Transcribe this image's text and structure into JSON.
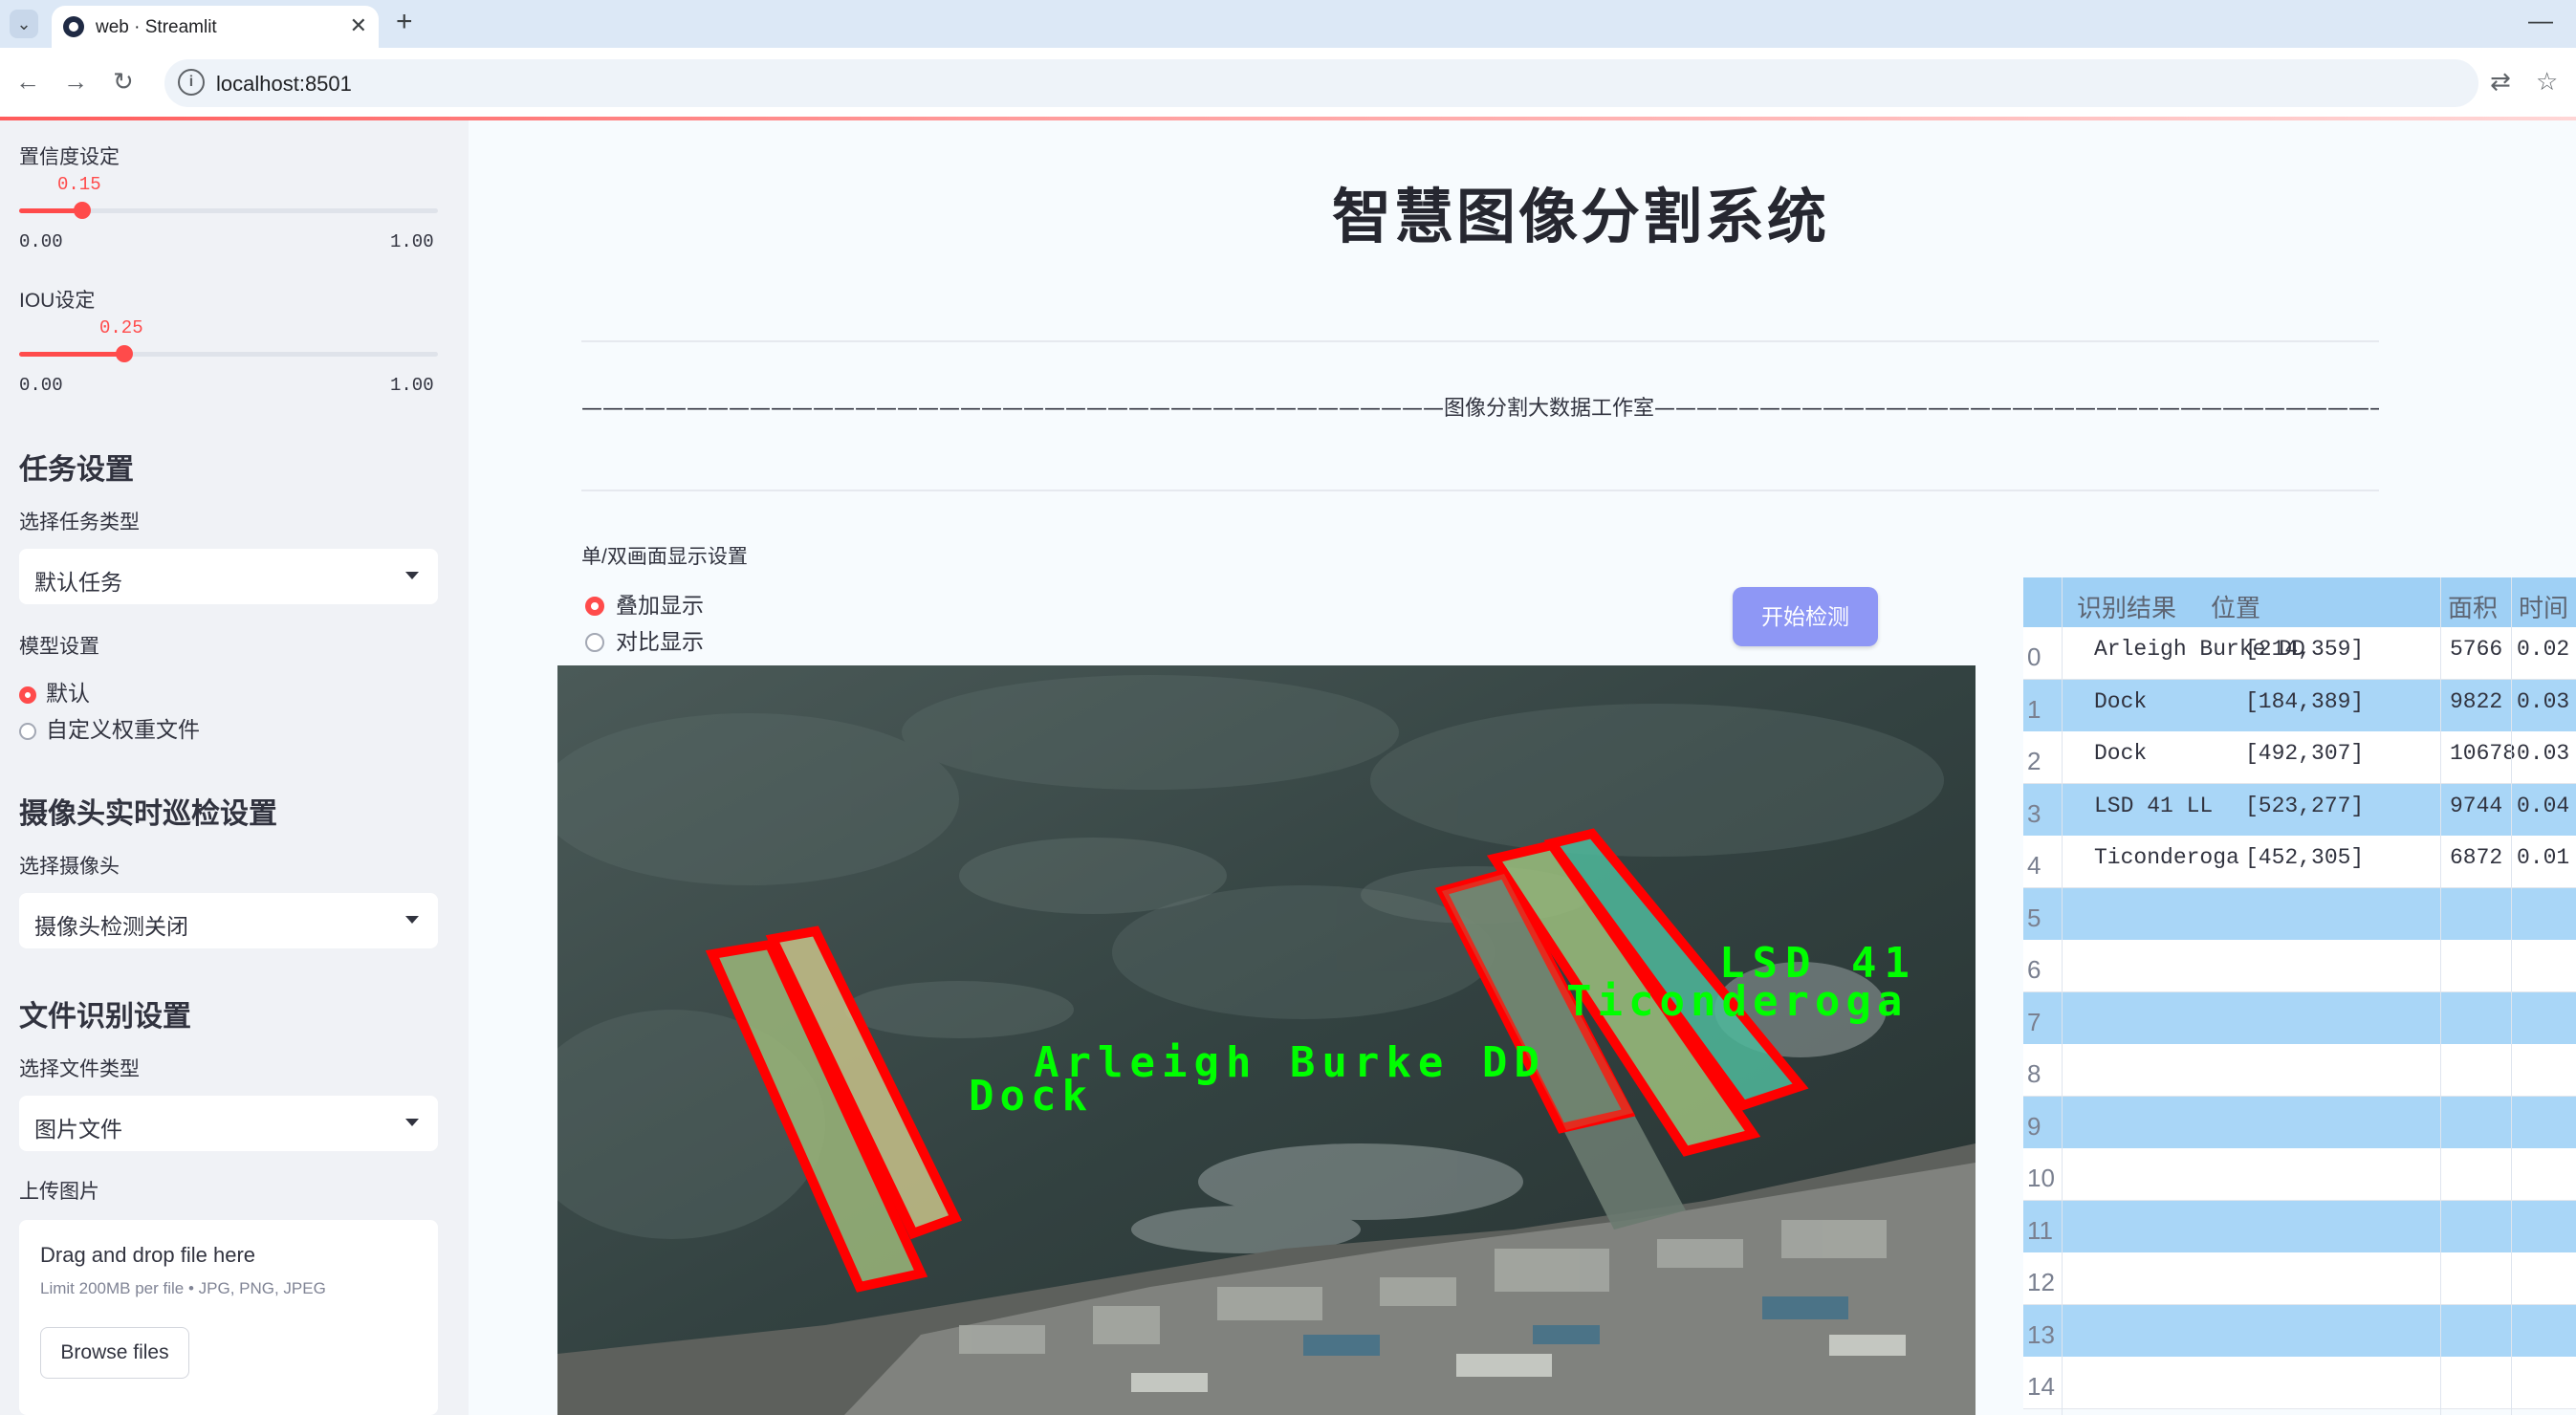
{
  "browser": {
    "tab_title": "web · Streamlit",
    "url": "localhost:8501"
  },
  "sidebar": {
    "confidence": {
      "label": "置信度设定",
      "value": "0.15",
      "min": "0.00",
      "max": "1.00",
      "fraction": 0.15
    },
    "iou": {
      "label": "IOU设定",
      "value": "0.25",
      "min": "0.00",
      "max": "1.00",
      "fraction": 0.25
    },
    "task_section": "任务设置",
    "task_type_label": "选择任务类型",
    "task_type_value": "默认任务",
    "model_label": "模型设置",
    "model_options": [
      "默认",
      "自定义权重文件"
    ],
    "camera_section": "摄像头实时巡检设置",
    "camera_label": "选择摄像头",
    "camera_value": "摄像头检测关闭",
    "file_section": "文件识别设置",
    "file_type_label": "选择文件类型",
    "file_type_value": "图片文件",
    "upload_label": "上传图片",
    "upload_drop": "Drag and drop file here",
    "upload_limit": "Limit 200MB per file • JPG, PNG, JPEG",
    "upload_button": "Browse files"
  },
  "main": {
    "title": "智慧图像分割系统",
    "dash_text": "—————————————————————————————————————————图像分割大数据工作室—————————————————————————————————————————",
    "mode_label": "单/双画面显示设置",
    "mode_options": [
      "叠加显示",
      "对比显示"
    ],
    "start_button": "开始检测"
  },
  "image_labels": {
    "l1": "LSD 41",
    "l2": "Ticonderoga",
    "l3": "Arleigh Burke DD",
    "l4": "Dock"
  },
  "table": {
    "headers": [
      "识别结果",
      "位置",
      "面积",
      "时间"
    ],
    "rows": [
      {
        "idx": "0",
        "result": "Arleigh Burke DD",
        "pos": "[214,359]",
        "area": "5766",
        "time": "0.02"
      },
      {
        "idx": "1",
        "result": "Dock",
        "pos": "[184,389]",
        "area": "9822",
        "time": "0.03"
      },
      {
        "idx": "2",
        "result": "Dock",
        "pos": "[492,307]",
        "area": "10678",
        "time": "0.03"
      },
      {
        "idx": "3",
        "result": "LSD 41 LL",
        "pos": "[523,277]",
        "area": "9744",
        "time": "0.04"
      },
      {
        "idx": "4",
        "result": "Ticonderoga",
        "pos": "[452,305]",
        "area": "6872",
        "time": "0.01"
      },
      {
        "idx": "5"
      },
      {
        "idx": "6"
      },
      {
        "idx": "7"
      },
      {
        "idx": "8"
      },
      {
        "idx": "9"
      },
      {
        "idx": "10"
      },
      {
        "idx": "11"
      },
      {
        "idx": "12"
      },
      {
        "idx": "13"
      },
      {
        "idx": "14"
      }
    ]
  },
  "colors": {
    "accent": "#ff4b4b",
    "button": "#8e97f5",
    "table_stripe": "#a9d6f7"
  }
}
